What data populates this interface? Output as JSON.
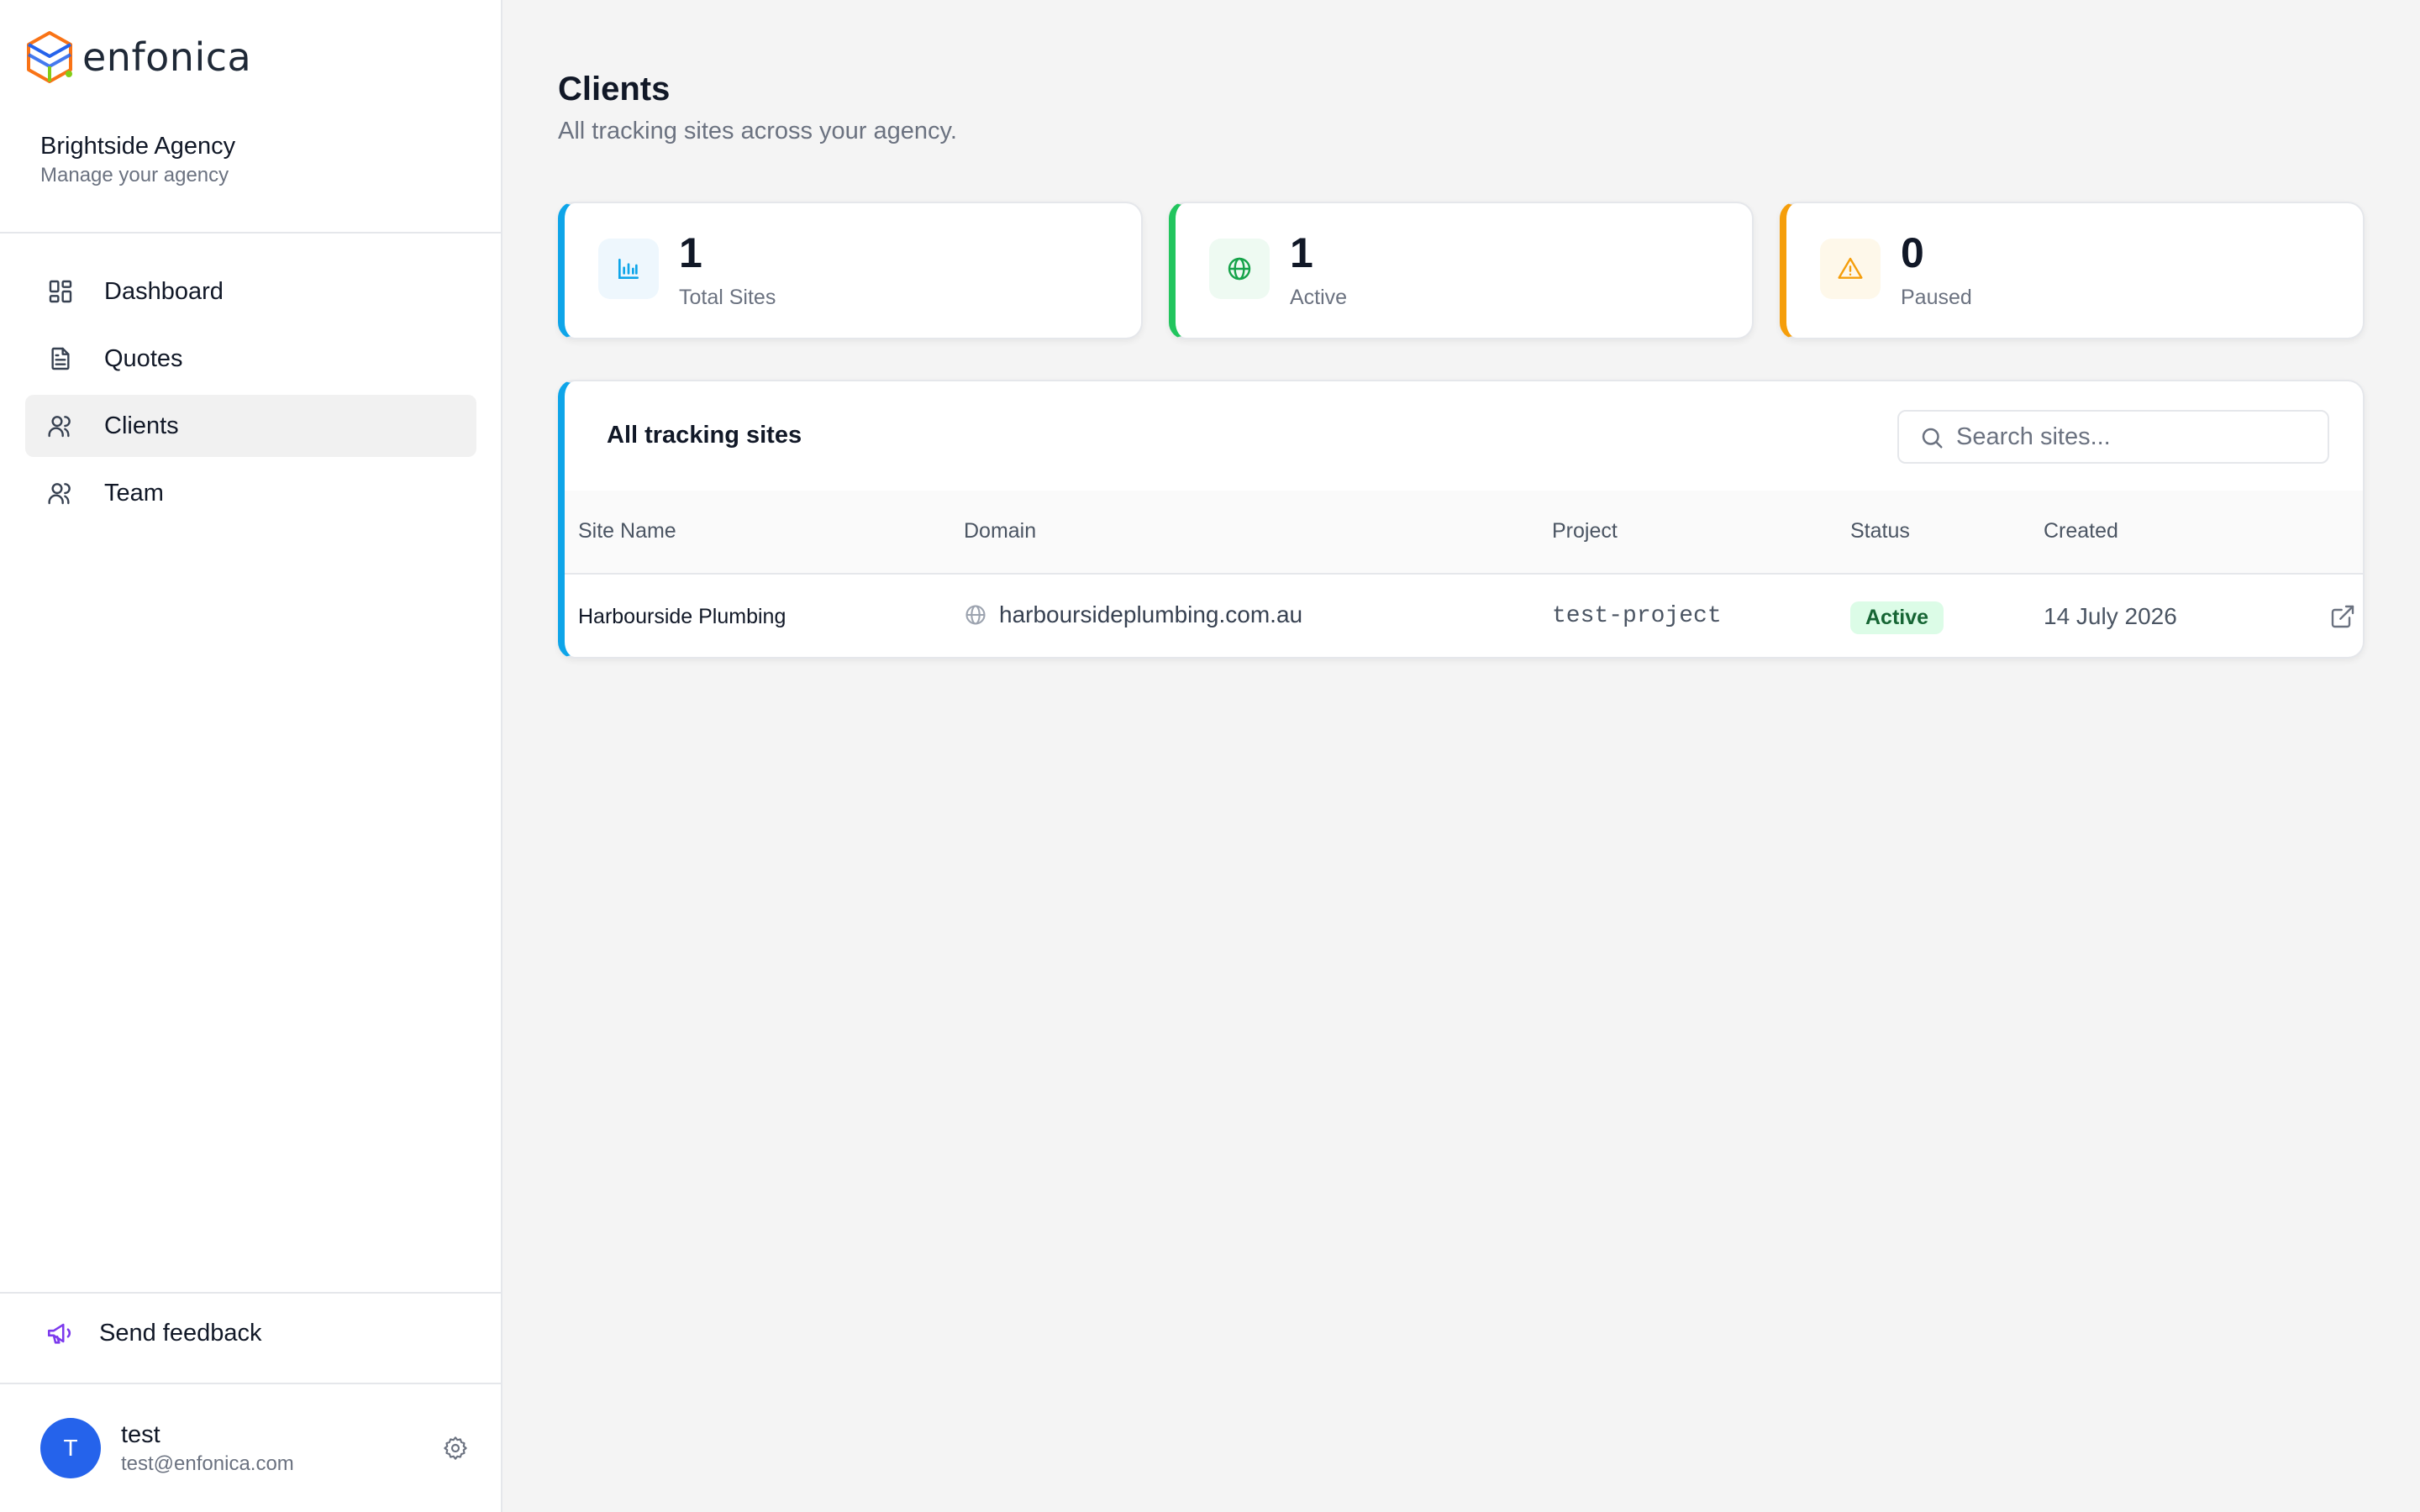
{
  "brand": {
    "name": "enfonica"
  },
  "org": {
    "name": "Brightside Agency",
    "subtitle": "Manage your agency"
  },
  "nav": {
    "items": [
      {
        "label": "Dashboard",
        "icon": "dashboard-icon"
      },
      {
        "label": "Quotes",
        "icon": "document-icon"
      },
      {
        "label": "Clients",
        "icon": "users-icon",
        "active": true
      },
      {
        "label": "Team",
        "icon": "users-icon"
      }
    ]
  },
  "feedback": {
    "label": "Send feedback",
    "icon": "megaphone-icon"
  },
  "user": {
    "initial": "T",
    "name": "test",
    "email": "test@enfonica.com"
  },
  "page": {
    "title": "Clients",
    "subtitle": "All tracking sites across your agency."
  },
  "stats": [
    {
      "value": "1",
      "label": "Total Sites",
      "icon": "bar-chart-icon",
      "color": "#0ea5e9"
    },
    {
      "value": "1",
      "label": "Active",
      "icon": "globe-icon",
      "color": "#22c55e"
    },
    {
      "value": "0",
      "label": "Paused",
      "icon": "warning-icon",
      "color": "#f59e0b"
    }
  ],
  "table": {
    "title": "All tracking sites",
    "search_placeholder": "Search sites...",
    "columns": [
      "Site Name",
      "Domain",
      "Project",
      "Status",
      "Created"
    ],
    "rows": [
      {
        "site_name": "Harbourside Plumbing",
        "domain": "harboursideplumbing.com.au",
        "project": "test-project",
        "status": "Active",
        "created": "14 July 2026"
      }
    ]
  },
  "colors": {
    "accent": "#0ea5e9",
    "active_green": "#22c55e",
    "paused_orange": "#f59e0b",
    "avatar": "#2563eb"
  }
}
